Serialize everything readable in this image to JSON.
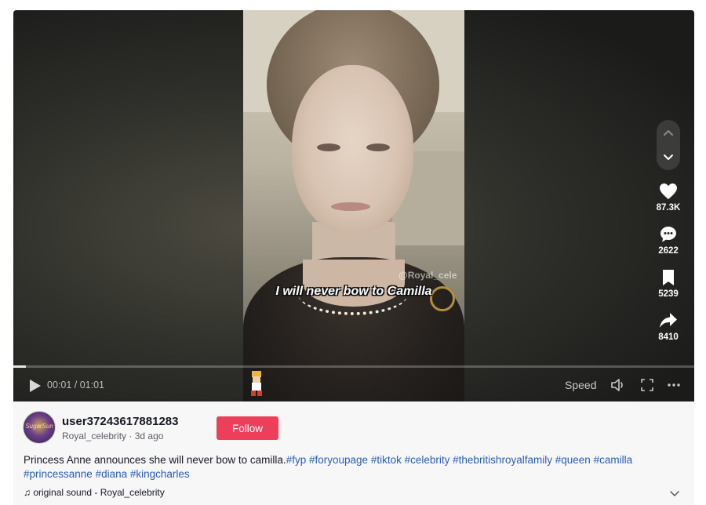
{
  "overlay": {
    "watermark": "@Royal_cele",
    "caption": "I will never bow to Camilla"
  },
  "controls": {
    "time": "00:01 / 01:01",
    "speed": "Speed",
    "progress": 0.018
  },
  "actions": {
    "likes": "87.3K",
    "comments": "2622",
    "saves": "5239",
    "shares": "8410"
  },
  "author": {
    "username": "user37243617881283",
    "nickname": "Royal_celebrity",
    "posted": "3d ago",
    "avatar_text": "SugarSun",
    "follow_label": "Follow"
  },
  "description": {
    "text": "Princess Anne announces she will never bow to camilla.",
    "hashtags": [
      "#fyp",
      "#foryoupage",
      "#tiktok",
      "#celebrity",
      "#thebritishroyalfamily",
      "#queen",
      "#camilla",
      "#princessanne",
      "#diana",
      "#kingcharles"
    ]
  },
  "sound": {
    "label": "original sound - Royal_celebrity"
  },
  "colors": {
    "follow_bg": "#ee3f5a",
    "hashtag": "#2b5db0",
    "text": "#161823"
  },
  "icons": [
    "play-icon",
    "volume-icon",
    "fullscreen-icon",
    "more-icon",
    "chevron-up-icon",
    "chevron-down-icon",
    "heart-icon",
    "comment-icon",
    "bookmark-icon",
    "share-icon",
    "music-note-icon",
    "expand-chevron-icon"
  ]
}
